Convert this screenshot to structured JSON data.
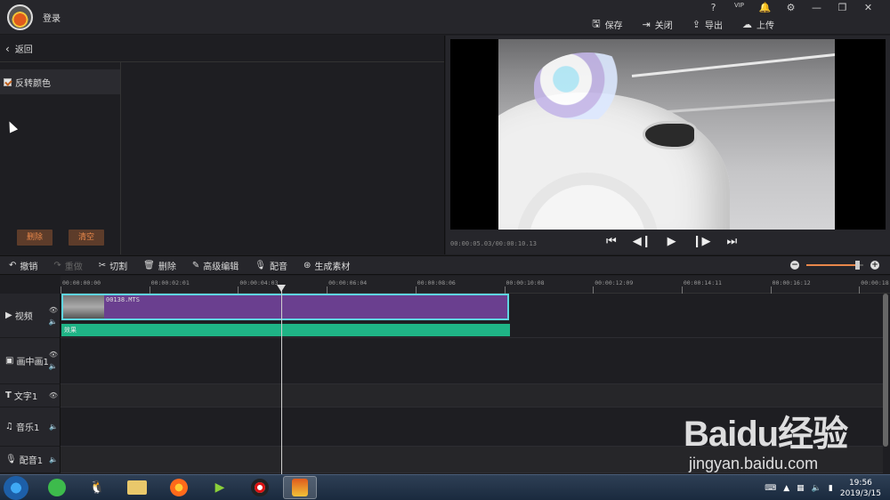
{
  "app": {
    "login": "登录",
    "window_icons": [
      "?",
      "VIP",
      "🔔",
      "⚙",
      "—",
      "❐",
      "✕"
    ],
    "actions": [
      {
        "icon": "save-icon",
        "glyph": "🖫",
        "label": "保存"
      },
      {
        "icon": "close-icon",
        "glyph": "⇥",
        "label": "关闭"
      },
      {
        "icon": "export-icon",
        "glyph": "⇪",
        "label": "导出"
      },
      {
        "icon": "upload-icon",
        "glyph": "☁",
        "label": "上传"
      }
    ]
  },
  "left_panel": {
    "back_label": "返回",
    "effect_item": "反转颜色",
    "delete_button": "删除",
    "clear_button": "清空"
  },
  "preview": {
    "timecode": "00:00:05.03/00:00:10.13"
  },
  "edit_toolbar": {
    "undo": "撤销",
    "redo": "重做",
    "cut": "切割",
    "delete": "删除",
    "advanced": "高级编辑",
    "dub": "配音",
    "generate": "生成素材",
    "zoom_level": 0.9
  },
  "timeline": {
    "ticks": [
      "00:00:00:00",
      "00:00:02:01",
      "00:00:04:03",
      "00:00:06:04",
      "00:00:08:06",
      "00:00:10:08",
      "00:00:12:09",
      "00:00:14:11",
      "00:00:16:12",
      "00:00:18:"
    ],
    "tracks": {
      "video": "视频",
      "pip": "画中画1",
      "text": "文字1",
      "music": "音乐1",
      "dub": "配音1"
    },
    "clip_name": "00138.MTS",
    "effect_label": "效果"
  },
  "watermark": {
    "brand": "Baidu经验",
    "url": "jingyan.baidu.com"
  },
  "taskbar": {
    "time": "19:56",
    "date": "2019/3/15"
  }
}
